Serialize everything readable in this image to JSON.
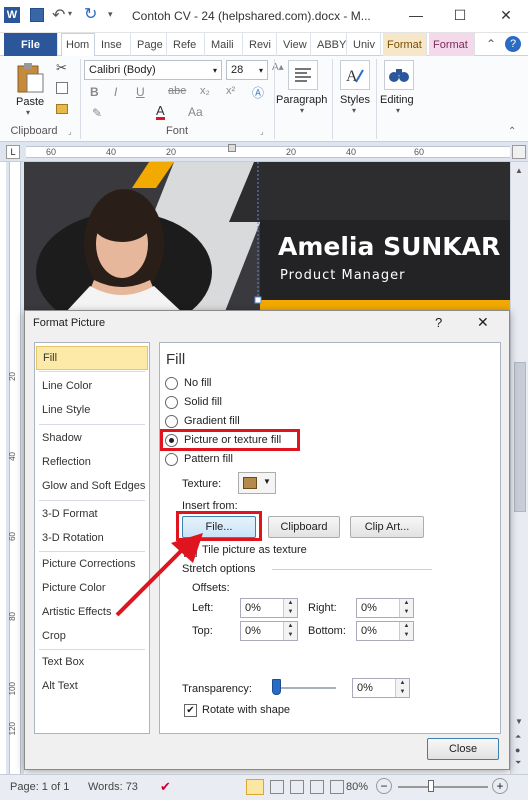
{
  "window": {
    "title": "Contoh CV - 24 (helpshared.com).docx - M...",
    "minimize": "—",
    "maximize": "☐",
    "close": "✕"
  },
  "tabs": [
    {
      "label": "File"
    },
    {
      "label": "Hom"
    },
    {
      "label": "Inse"
    },
    {
      "label": "Page"
    },
    {
      "label": "Refe"
    },
    {
      "label": "Maili"
    },
    {
      "label": "Revi"
    },
    {
      "label": "View"
    },
    {
      "label": "ABBY"
    },
    {
      "label": "Univ"
    },
    {
      "label": "Format"
    },
    {
      "label": "Format"
    }
  ],
  "ribbon": {
    "clipboard": {
      "paste": "Paste",
      "group": "Clipboard"
    },
    "font": {
      "name": "Calibri (Body)",
      "size": "28",
      "group": "Font",
      "bold": "B",
      "italic": "I",
      "underline": "U",
      "strike": "abe",
      "sub": "x₂",
      "sup": "x²",
      "color": "A",
      "case": "Aa"
    },
    "paragraph": "Paragraph",
    "styles": "Styles",
    "editing": "Editing"
  },
  "ruler": {
    "marks": [
      "60",
      "40",
      "20",
      "20",
      "40",
      "60"
    ]
  },
  "vruler_marks": [
    "20",
    "40",
    "60",
    "80",
    "100",
    "120"
  ],
  "document": {
    "name": "Amelia SUNKAR",
    "role": "Product Manager"
  },
  "dialog": {
    "title": "Format Picture",
    "help": "?",
    "close": "✕",
    "nav": [
      "Fill",
      "Line Color",
      "Line Style",
      "Shadow",
      "Reflection",
      "Glow and Soft Edges",
      "3-D Format",
      "3-D Rotation",
      "Picture Corrections",
      "Picture Color",
      "Artistic Effects",
      "Crop",
      "Text Box",
      "Alt Text"
    ],
    "fill": {
      "heading": "Fill",
      "options": [
        "No fill",
        "Solid fill",
        "Gradient fill",
        "Picture or texture fill",
        "Pattern fill"
      ],
      "texture_label": "Texture:",
      "insert_from": "Insert from:",
      "file_button": "File...",
      "clipboard_button": "Clipboard",
      "clipart_button": "Clip Art...",
      "tile_label": "Tile picture as texture",
      "stretch_options": "Stretch options",
      "offsets": "Offsets:",
      "left_label": "Left:",
      "left_value": "0%",
      "right_label": "Right:",
      "right_value": "0%",
      "top_label": "Top:",
      "top_value": "0%",
      "bottom_label": "Bottom:",
      "bottom_value": "0%",
      "transparency_label": "Transparency:",
      "transparency_value": "0%",
      "transparency_level": 0,
      "rotate_label": "Rotate with shape"
    },
    "close_button": "Close"
  },
  "status": {
    "page": "Page: 1 of 1",
    "words": "Words: 73",
    "zoom": "80%",
    "zoom_out": "−",
    "zoom_in": "+"
  },
  "colors": {
    "accent": "#2b579a",
    "highlight": "#e0141e",
    "gold": "#f2a900",
    "nav_selected": "#fde9a8"
  }
}
